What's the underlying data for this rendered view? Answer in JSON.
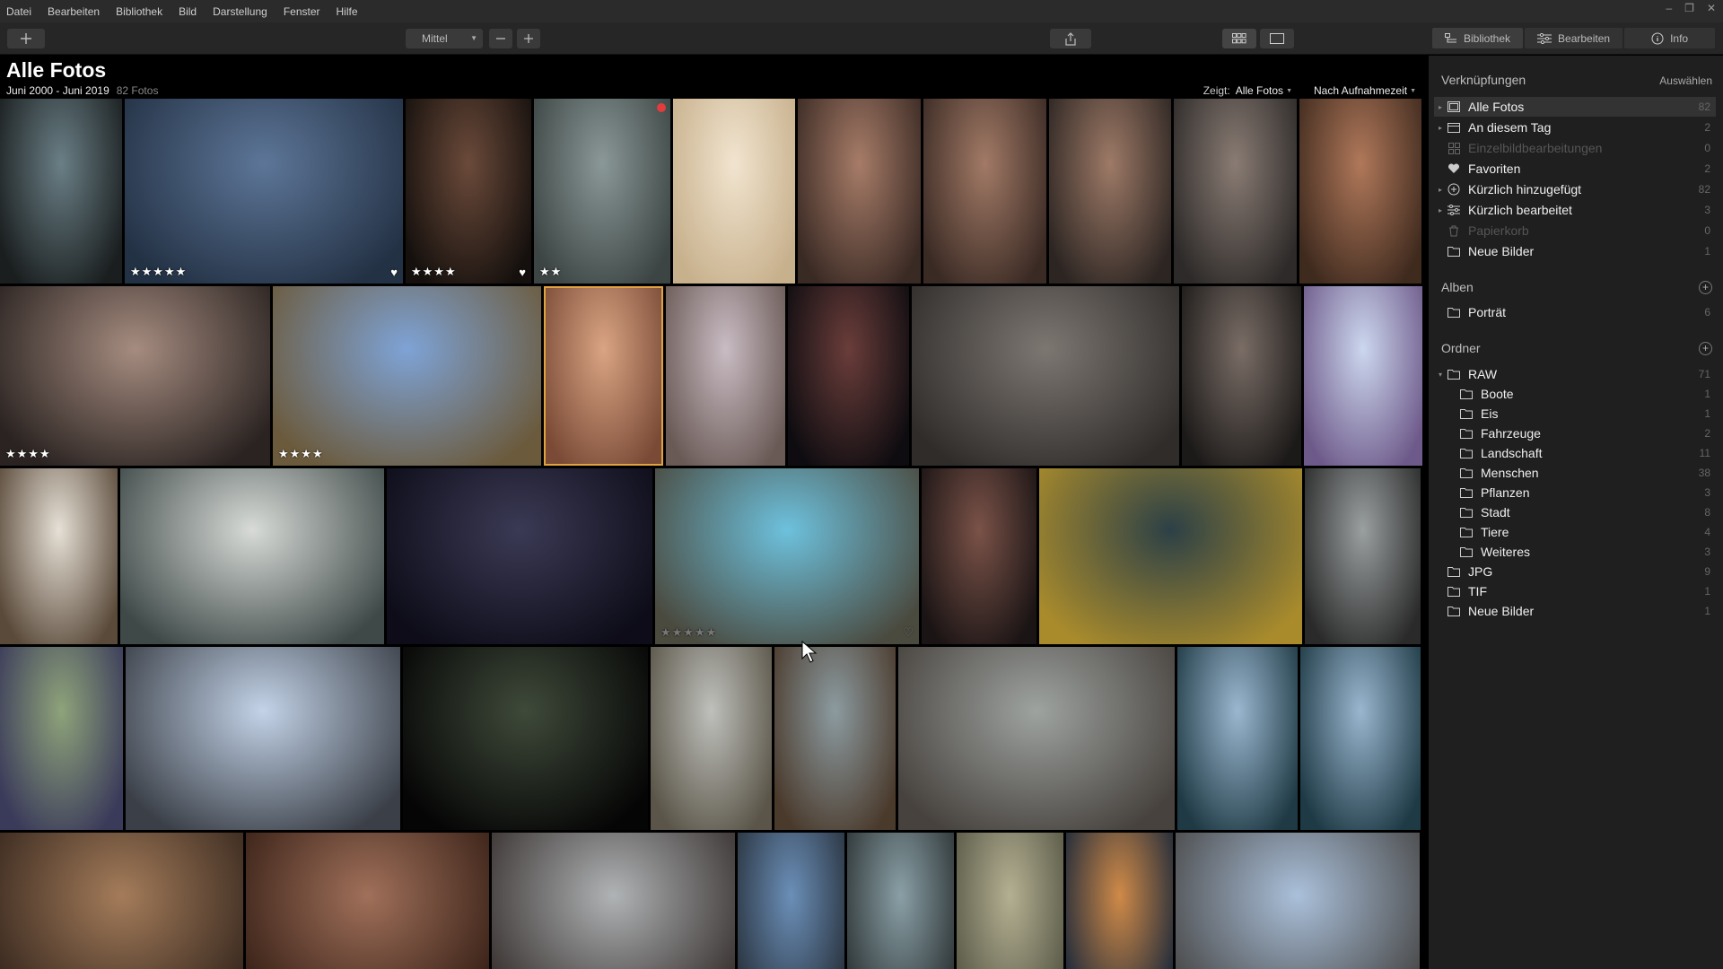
{
  "menu": [
    "Datei",
    "Bearbeiten",
    "Bibliothek",
    "Bild",
    "Darstellung",
    "Fenster",
    "Hilfe"
  ],
  "toolbar": {
    "zoom_value": "Mittel",
    "tabs": [
      {
        "label": "Bibliothek",
        "icon": "library-icon",
        "active": true
      },
      {
        "label": "Bearbeiten",
        "icon": "sliders-icon",
        "active": false
      },
      {
        "label": "Info",
        "icon": "info-icon",
        "active": false
      }
    ]
  },
  "main": {
    "title": "Alle Fotos",
    "date_range": "Juni 2000 - Juni 2019",
    "photo_count": "82 Fotos",
    "show_label": "Zeigt:",
    "show_value": "Alle Fotos",
    "sort_value": "Nach Aufnahmezeit"
  },
  "rows": [
    {
      "photos": [
        {
          "c1": "#6a7f86",
          "c2": "#1a1e1f",
          "stars": ""
        },
        {
          "c1": "#5d7698",
          "c2": "#233144",
          "stars": "★★★★★",
          "heart": true
        },
        {
          "c1": "#6b4a3a",
          "c2": "#15100d",
          "stars": "★★★★",
          "heart": true
        },
        {
          "c1": "#8a9897",
          "c2": "#3c4544",
          "stars": "★★",
          "reddot": true
        },
        {
          "c1": "#f1e4cf",
          "c2": "#c7b08c"
        },
        {
          "c1": "#a77c68",
          "c2": "#3a2a24"
        },
        {
          "c1": "#a27a66",
          "c2": "#3a2a24"
        },
        {
          "c1": "#9e7a67",
          "c2": "#2c2522"
        },
        {
          "c1": "#8a7c74",
          "c2": "#2d2a29"
        },
        {
          "c1": "#b0785a",
          "c2": "#3f2a1e"
        }
      ]
    },
    {
      "photos": [
        {
          "c1": "#a68c80",
          "c2": "#2a2321",
          "stars": "★★★★"
        },
        {
          "c1": "#7ea3d6",
          "c2": "#6b5a3c",
          "stars": "★★★★"
        },
        {
          "c1": "#d9a483",
          "c2": "#7a4a36"
        },
        {
          "c1": "#c9bcc3",
          "c2": "#6a5a56"
        },
        {
          "c1": "#6a3d3a",
          "c2": "#0e0c10"
        },
        {
          "c1": "#7d7772",
          "c2": "#2f2c2a"
        },
        {
          "c1": "#7a6d66",
          "c2": "#1c1a19"
        },
        {
          "c1": "#ccd7ee",
          "c2": "#6e5a8a"
        }
      ]
    },
    {
      "photos": [
        {
          "c1": "#e6e0d6",
          "c2": "#5a4a3a"
        },
        {
          "c1": "#d8dbd8",
          "c2": "#3f4a48"
        },
        {
          "c1": "#3b3a55",
          "c2": "#0d0c18"
        },
        {
          "c1": "#6dc1dd",
          "c2": "#4a4a3f",
          "stars": "★★★★★",
          "dimstars": true,
          "heart": true,
          "dimheart": true
        },
        {
          "c1": "#7a5248",
          "c2": "#1a1414"
        },
        {
          "c1": "#2c4046",
          "c2": "#a98b2c"
        },
        {
          "c1": "#9a9fa0",
          "c2": "#2a2a2a"
        }
      ]
    },
    {
      "photos": [
        {
          "c1": "#8ea37a",
          "c2": "#3a3a5a"
        },
        {
          "c1": "#c3d3e8",
          "c2": "#3b4048"
        },
        {
          "c1": "#3f4a3a",
          "c2": "#050505"
        },
        {
          "c1": "#bfc0bc",
          "c2": "#5a5548"
        },
        {
          "c1": "#8c9ba0",
          "c2": "#4a3a2c"
        },
        {
          "c1": "#9ea3a0",
          "c2": "#47423e"
        },
        {
          "c1": "#9bb7d0",
          "c2": "#1f3a44"
        },
        {
          "c1": "#9ab6cf",
          "c2": "#1e3a45"
        }
      ]
    },
    {
      "photos": [
        {
          "c1": "#a47c5a",
          "c2": "#3a2a20"
        },
        {
          "c1": "#a0705a",
          "c2": "#3a2218"
        },
        {
          "c1": "#b0b3b5",
          "c2": "#3a3432"
        },
        {
          "c1": "#6b8fb8",
          "c2": "#2a3440"
        },
        {
          "c1": "#8aa0a6",
          "c2": "#2f3638"
        },
        {
          "c1": "#b4b092",
          "c2": "#5a5a48"
        },
        {
          "c1": "#cf8a48",
          "c2": "#1f2a3a"
        },
        {
          "c1": "#aac0da",
          "c2": "#4a4a4a"
        }
      ]
    }
  ],
  "sidebar": {
    "links_title": "Verknüpfungen",
    "links_action": "Auswählen",
    "links": [
      {
        "label": "Alle Fotos",
        "count": "82",
        "icon": "photos-icon"
      },
      {
        "label": "An diesem Tag",
        "count": "2",
        "icon": "calendar-icon"
      },
      {
        "label": "Einzelbildbearbeitungen",
        "count": "0",
        "icon": "grid-icon"
      },
      {
        "label": "Favoriten",
        "count": "2",
        "icon": "heart-icon"
      },
      {
        "label": "Kürzlich hinzugefügt",
        "count": "82",
        "icon": "plus-circle-icon"
      },
      {
        "label": "Kürzlich bearbeitet",
        "count": "3",
        "icon": "sliders-icon"
      },
      {
        "label": "Papierkorb",
        "count": "0",
        "icon": "trash-icon"
      },
      {
        "label": "Neue Bilder",
        "count": "1",
        "icon": "folder-icon"
      }
    ],
    "albums_title": "Alben",
    "albums": [
      {
        "label": "Porträt",
        "count": "6"
      }
    ],
    "folders_title": "Ordner",
    "folders": [
      {
        "label": "RAW",
        "count": "71"
      },
      {
        "label": "Boote",
        "count": "1"
      },
      {
        "label": "Eis",
        "count": "1"
      },
      {
        "label": "Fahrzeuge",
        "count": "2"
      },
      {
        "label": "Landschaft",
        "count": "11"
      },
      {
        "label": "Menschen",
        "count": "38"
      },
      {
        "label": "Pflanzen",
        "count": "3"
      },
      {
        "label": "Stadt",
        "count": "8"
      },
      {
        "label": "Tiere",
        "count": "4"
      },
      {
        "label": "Weiteres",
        "count": "3"
      },
      {
        "label": "JPG",
        "count": "9"
      },
      {
        "label": "TIF",
        "count": "1"
      },
      {
        "label": "Neue Bilder",
        "count": "1"
      }
    ]
  }
}
